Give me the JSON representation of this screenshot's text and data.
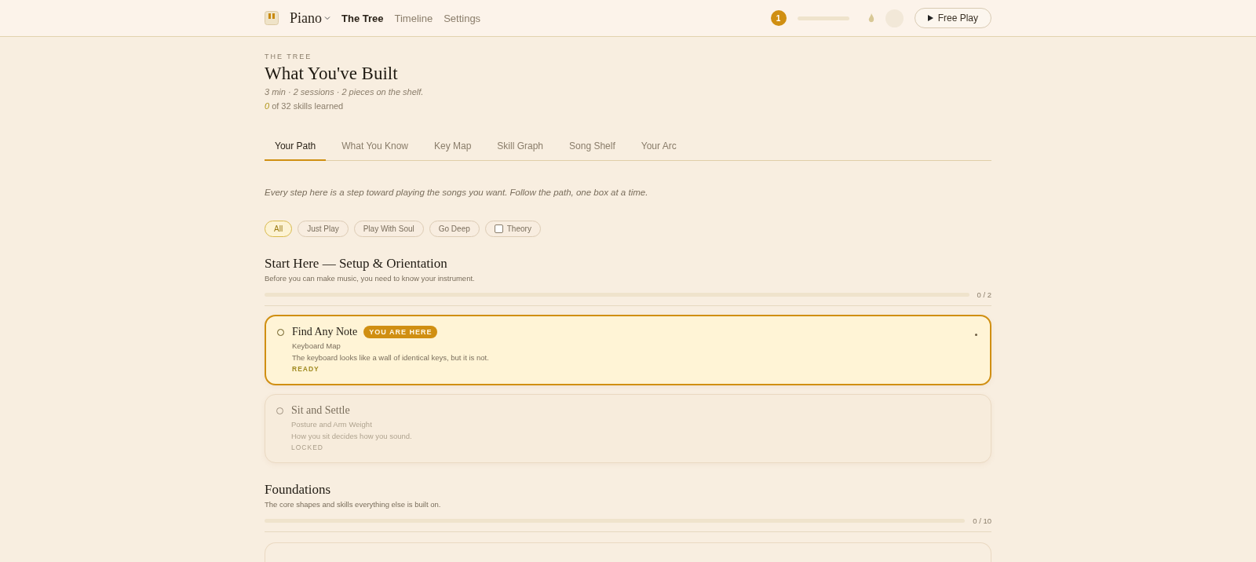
{
  "header": {
    "app_name": "Piano",
    "nav": [
      {
        "label": "The Tree",
        "selected": true
      },
      {
        "label": "Timeline",
        "selected": false
      },
      {
        "label": "Settings",
        "selected": false
      }
    ],
    "level_badge": "1",
    "xp": {
      "level": 0
    },
    "free_play": "Free Play"
  },
  "page": {
    "eyebrow": "THE TREE",
    "title": "What You've Built",
    "stats": "3 min · 2 sessions · 2 pieces on the shelf.",
    "skills_count": "0",
    "skills_text": "of 32 skills learned"
  },
  "tabs": [
    {
      "label": "Your Path",
      "selected": true
    },
    {
      "label": "What You Know",
      "selected": false
    },
    {
      "label": "Key Map",
      "selected": false
    },
    {
      "label": "Skill Graph",
      "selected": false
    },
    {
      "label": "Song Shelf",
      "selected": false
    },
    {
      "label": "Your Arc",
      "selected": false
    }
  ],
  "intro": "Every step here is a step toward playing the songs you want. Follow the path, one box at a time.",
  "filters": [
    {
      "kind": "chip",
      "label": "All",
      "selected": true
    },
    {
      "kind": "chip",
      "label": "Just Play",
      "selected": false
    },
    {
      "kind": "chip",
      "label": "Play With Soul",
      "selected": false
    },
    {
      "kind": "chip",
      "label": "Go Deep",
      "selected": false
    },
    {
      "kind": "checkbox",
      "label": "Theory",
      "checked": false
    }
  ],
  "sections": [
    {
      "title": "Start Here — Setup & Orientation",
      "description": "Before you can make music, you need to know your instrument.",
      "progress": {
        "level": 0,
        "text": "0 / 2"
      },
      "cards": [
        {
          "title": "Find Any Note",
          "badge": "YOU ARE HERE",
          "subtitle": "Keyboard Map",
          "description": "The keyboard looks like a wall of identical keys, but it is not.",
          "status": "READY",
          "kind": "ready"
        },
        {
          "title": "Sit and Settle",
          "subtitle": "Posture and Arm Weight",
          "description": "How you sit decides how you sound.",
          "status": "LOCKED",
          "kind": "locked"
        }
      ]
    },
    {
      "title": "Foundations",
      "description": "The core shapes and skills everything else is built on.",
      "progress": {
        "level": 0,
        "text": "0 / 10"
      }
    }
  ]
}
